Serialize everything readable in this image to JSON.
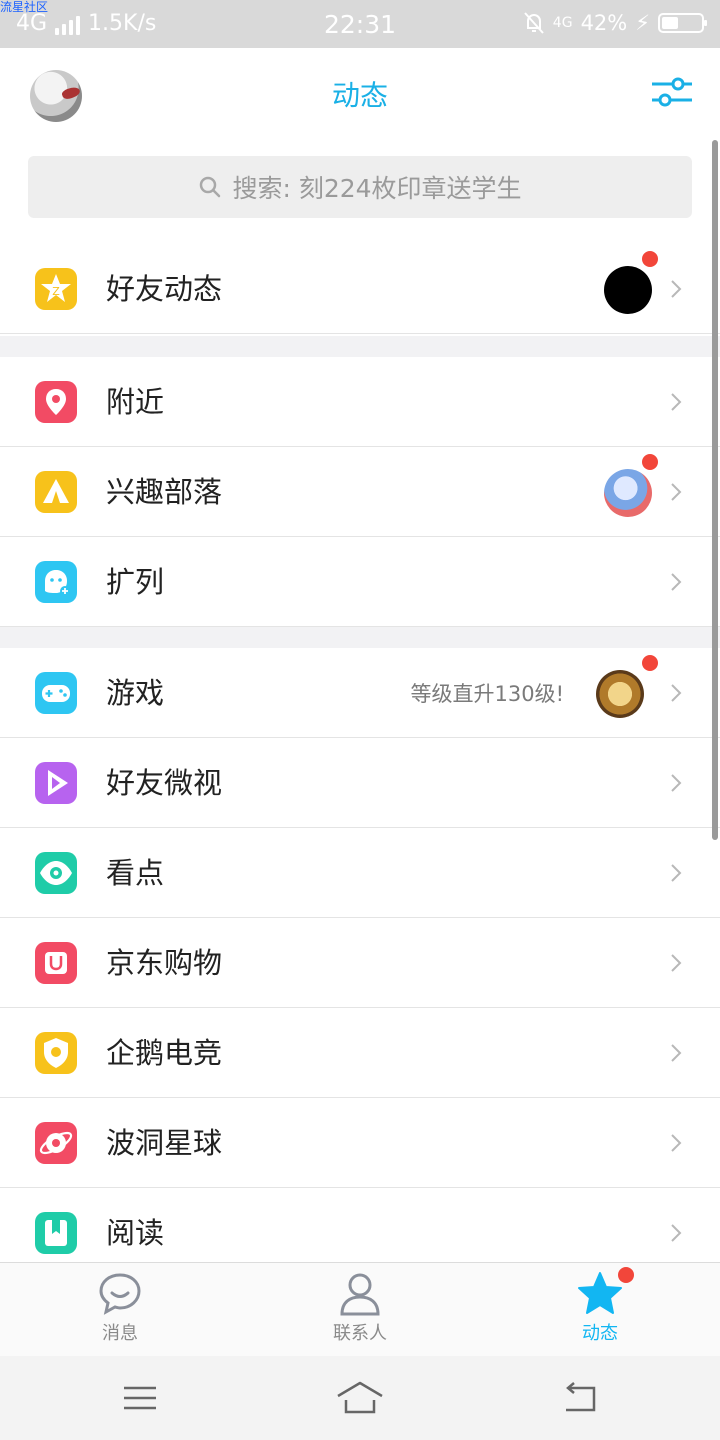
{
  "status_bar": {
    "watermark": "流星社区",
    "network": "4G",
    "speed": "1.5K/s",
    "time": "22:31",
    "network2": "4G",
    "battery": "42%",
    "battery_level": 0.42
  },
  "header": {
    "title": "动态"
  },
  "search": {
    "placeholder": "搜索: 刻224枚印章送学生"
  },
  "list": {
    "items": [
      {
        "label": "好友动态",
        "icon": "friends-feed-icon",
        "color": "#f7c21b",
        "badge": true
      },
      {
        "label": "附近",
        "icon": "location-pin-icon",
        "color": "#f24b64"
      },
      {
        "label": "兴趣部落",
        "icon": "tribe-tent-icon",
        "color": "#f7c21b",
        "badge": true
      },
      {
        "label": "扩列",
        "icon": "expand-friends-icon",
        "color": "#2ec6f2"
      },
      {
        "label": "游戏",
        "icon": "gamepad-icon",
        "color": "#2ec6f2",
        "note": "等级直升130级!",
        "badge": true
      },
      {
        "label": "好友微视",
        "icon": "video-play-icon",
        "color": "#b763ef"
      },
      {
        "label": "看点",
        "icon": "eye-icon",
        "color": "#1fcca8"
      },
      {
        "label": "京东购物",
        "icon": "shopping-bag-icon",
        "color": "#f24b64"
      },
      {
        "label": "企鹅电竞",
        "icon": "esports-shield-icon",
        "color": "#f7c21b"
      },
      {
        "label": "波洞星球",
        "icon": "planet-icon",
        "color": "#f24b64"
      },
      {
        "label": "阅读",
        "icon": "book-icon",
        "color": "#1fcca8"
      }
    ]
  },
  "tabs": {
    "messages": "消息",
    "contacts": "联系人",
    "feed": "动态"
  },
  "colors": {
    "accent": "#1ab0e6",
    "badge": "#f2463a"
  }
}
